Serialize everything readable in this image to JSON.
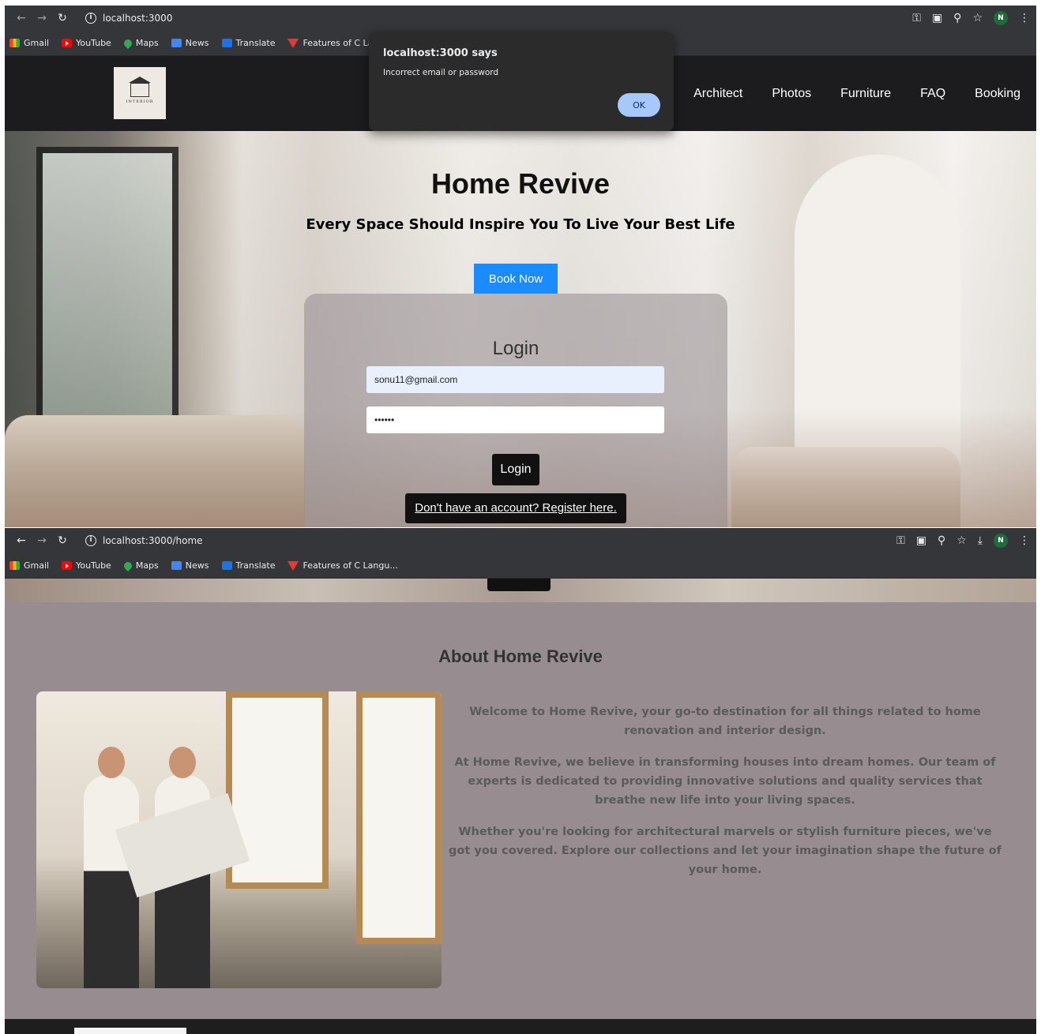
{
  "window1": {
    "url": "localhost:3000",
    "bookmarks": [
      "Gmail",
      "YouTube",
      "Maps",
      "News",
      "Translate",
      "Features of C Langu..."
    ],
    "avatar_letter": "N",
    "alert": {
      "title": "localhost:3000 says",
      "message": "Incorrect email or password",
      "ok": "OK"
    },
    "site": {
      "logo_text": "INTERIOR",
      "nav": [
        "Architect",
        "Photos",
        "Furniture",
        "FAQ",
        "Booking"
      ],
      "hero_title": "Home Revive",
      "hero_subtitle": "Every Space Should Inspire You To Live Your Best Life",
      "book_now": "Book Now",
      "login": {
        "title": "Login",
        "email_value": "sonu11@gmail.com",
        "password_value": "••••••",
        "submit": "Login",
        "register_link": "Don't have an account? Register here."
      }
    }
  },
  "window2": {
    "url": "localhost:3000/home",
    "bookmarks": [
      "Gmail",
      "YouTube",
      "Maps",
      "News",
      "Translate",
      "Features of C Langu..."
    ],
    "avatar_letter": "N",
    "about": {
      "title": "About Home Revive",
      "paragraphs": [
        "Welcome to Home Revive, your go-to destination for all things related to home renovation and interior design.",
        "At Home Revive, we believe in transforming houses into dream homes. Our team of experts is dedicated to providing innovative solutions and quality services that breathe new life into your living spaces.",
        "Whether you're looking for architectural marvels or stylish furniture pieces, we've got you covered. Explore our collections and let your imagination shape the future of your home."
      ]
    }
  },
  "colors": {
    "header_bg": "#1c1c1e",
    "book_button": "#1a8cff",
    "about_bg": "#978c8f",
    "alert_ok": "#a8c7fa"
  }
}
